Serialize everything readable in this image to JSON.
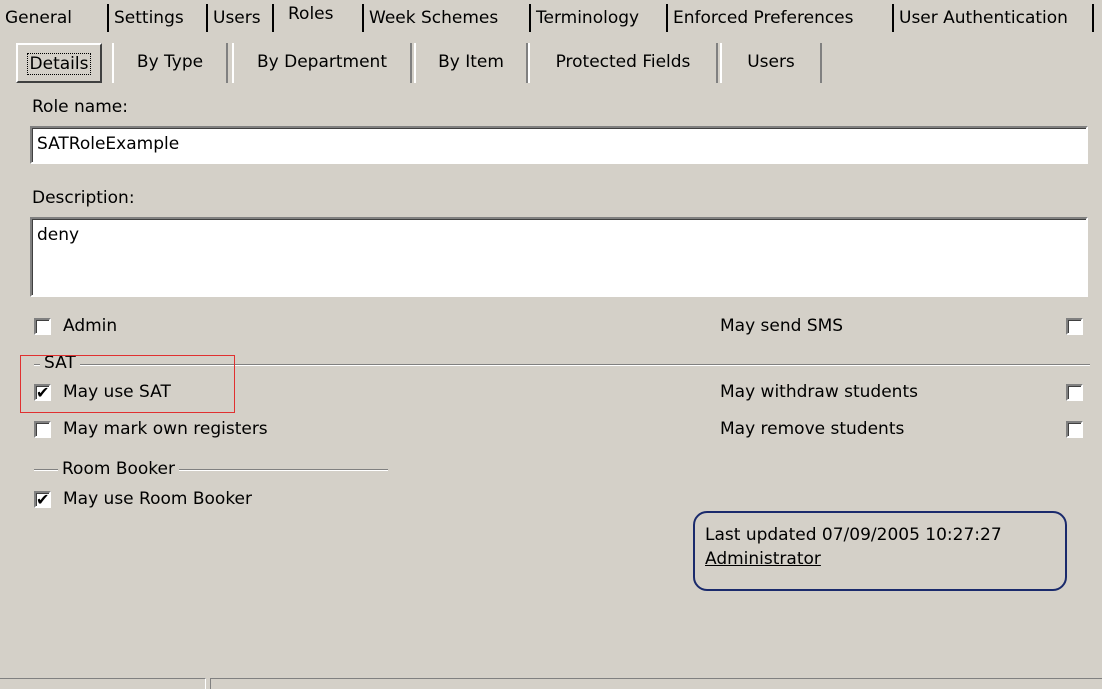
{
  "top_tabs": [
    "General",
    "Settings",
    "Users",
    "Roles",
    "Week Schemes",
    "Terminology",
    "Enforced Preferences",
    "User Authentication"
  ],
  "sub_tabs": [
    "Details",
    "By Type",
    "By Department",
    "By Item",
    "Protected Fields",
    "Users"
  ],
  "form": {
    "role_name_label": "Role name:",
    "role_name_value": "SATRoleExample",
    "description_label": "Description:",
    "description_value": "deny"
  },
  "checkboxes": {
    "admin": {
      "label": "Admin",
      "checked": false
    },
    "may_send_sms": {
      "label": "May send SMS",
      "checked": false
    },
    "may_use_sat": {
      "label": "May use SAT",
      "checked": true
    },
    "may_withdraw_students": {
      "label": "May withdraw students",
      "checked": false
    },
    "may_mark_own_registers": {
      "label": "May mark own registers",
      "checked": false
    },
    "may_remove_students": {
      "label": "May remove students",
      "checked": false
    },
    "may_use_room_booker": {
      "label": "May use Room Booker",
      "checked": true
    }
  },
  "groups": {
    "sat": "SAT",
    "room_booker": "Room Booker"
  },
  "info": {
    "last_updated": "Last updated 07/09/2005 10:27:27",
    "user": "Administrator"
  },
  "check_glyph": "✔",
  "colors": {
    "highlight_box": "#e03030",
    "info_border": "#1a2a6c"
  }
}
